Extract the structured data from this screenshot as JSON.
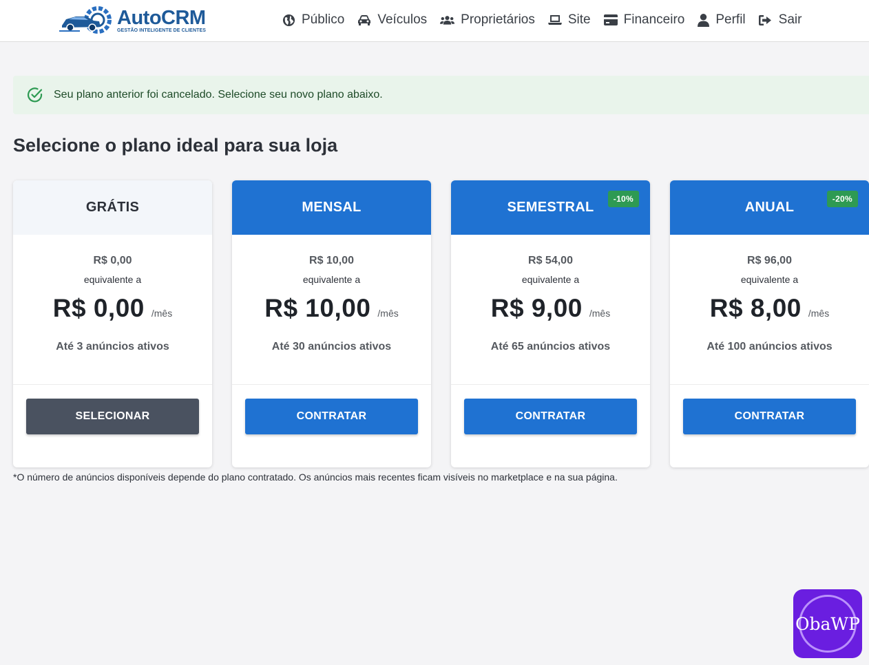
{
  "header": {
    "logo_name": "AutoCRM",
    "logo_tagline": "GESTÃO INTELIGENTE DE CLIENTES",
    "nav": [
      {
        "label": "Público",
        "icon": "globe-icon"
      },
      {
        "label": "Veículos",
        "icon": "car-icon"
      },
      {
        "label": "Proprietários",
        "icon": "users-icon"
      },
      {
        "label": "Site",
        "icon": "laptop-icon"
      },
      {
        "label": "Financeiro",
        "icon": "credit-card-icon"
      },
      {
        "label": "Perfil",
        "icon": "user-icon"
      },
      {
        "label": "Sair",
        "icon": "sign-out-icon"
      }
    ]
  },
  "alert": {
    "icon": "check-circle-icon",
    "text": "Seu plano anterior foi cancelado. Selecione seu novo plano abaixo."
  },
  "page_title": "Selecione o plano ideal para sua loja",
  "plans": [
    {
      "name": "GRÁTIS",
      "badge": "",
      "total": "R$ 0,00",
      "equiv": "equivalente a",
      "price": "R$ 0,00",
      "per": "/mês",
      "limit": "Até 3 anúncios ativos",
      "button": "SELECIONAR"
    },
    {
      "name": "MENSAL",
      "badge": "",
      "total": "R$ 10,00",
      "equiv": "equivalente a",
      "price": "R$ 10,00",
      "per": "/mês",
      "limit": "Até 30 anúncios ativos",
      "button": "CONTRATAR"
    },
    {
      "name": "SEMESTRAL",
      "badge": "-10%",
      "total": "R$ 54,00",
      "equiv": "equivalente a",
      "price": "R$ 9,00",
      "per": "/mês",
      "limit": "Até 65 anúncios ativos",
      "button": "CONTRATAR"
    },
    {
      "name": "ANUAL",
      "badge": "-20%",
      "total": "R$ 96,00",
      "equiv": "equivalente a",
      "price": "R$ 8,00",
      "per": "/mês",
      "limit": "Até 100 anúncios ativos",
      "button": "CONTRATAR"
    }
  ],
  "footnote": "*O número de anúncios disponíveis depende do plano contratado. Os anúncios mais recentes ficam visíveis no marketplace e na sua página.",
  "watermark": "ObaWP",
  "colors": {
    "primary": "#1f72d2",
    "success": "#2e9a53",
    "dark_button": "#4a5260",
    "watermark_bg": "#6a1ee0"
  }
}
